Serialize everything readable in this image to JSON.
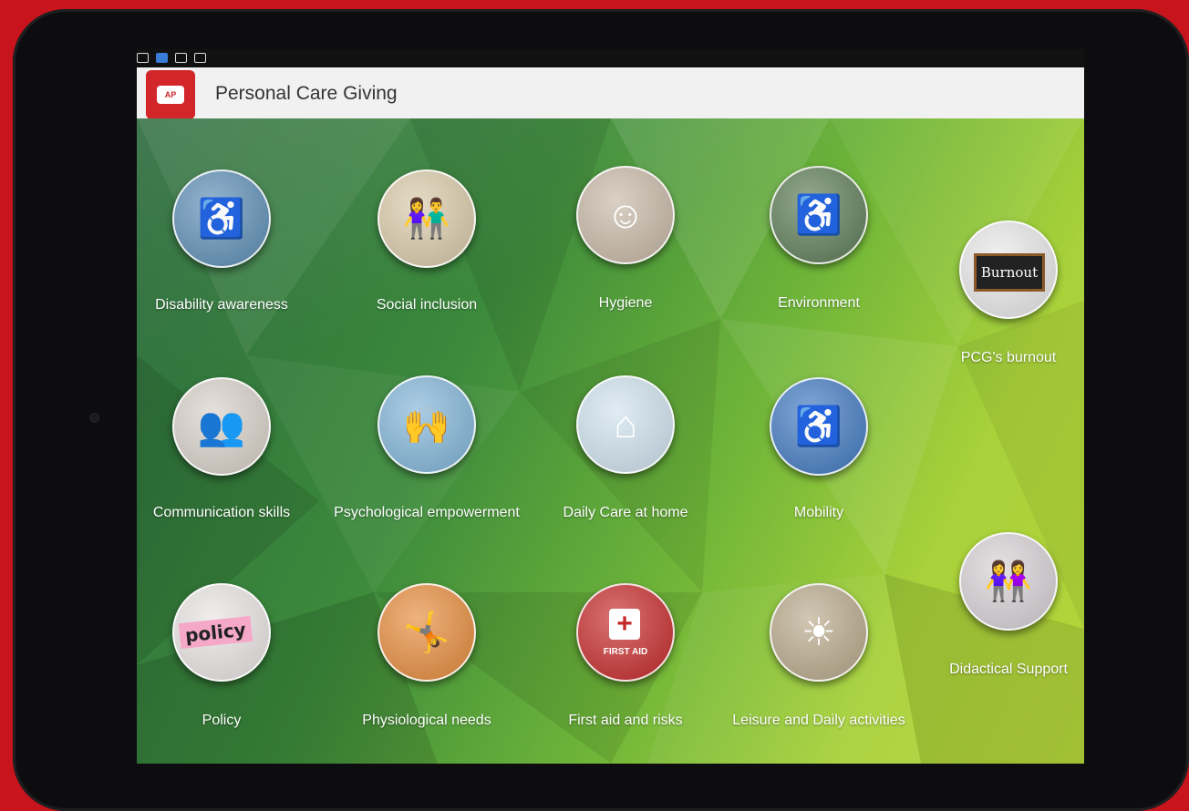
{
  "app": {
    "title": "Personal Care Giving",
    "logo_text": "AP"
  },
  "tiles": [
    {
      "label": "Disability awareness",
      "icon": "wheelchair-person-icon",
      "bg": "#5b8db5"
    },
    {
      "label": "Social inclusion",
      "icon": "paper-people-icon",
      "bg": "#d9c9a8"
    },
    {
      "label": "Hygiene",
      "icon": "elderly-face-icon",
      "bg": "#c7b7a5"
    },
    {
      "label": "Environment",
      "icon": "wheelchair-park-icon",
      "bg": "#5b7a55"
    },
    {
      "label": "PCG's burnout",
      "icon": "burnout-board-icon",
      "bg": "#e8e8e8"
    },
    {
      "label": "Communication skills",
      "icon": "meeting-icon",
      "bg": "#d8d0c8"
    },
    {
      "label": "Psychological empowerment",
      "icon": "arms-raised-icon",
      "bg": "#7fb4d8"
    },
    {
      "label": "Daily Care at home",
      "icon": "house-wheelchair-icon",
      "bg": "#cfe2ee"
    },
    {
      "label": "Mobility",
      "icon": "accessibility-sign-icon",
      "bg": "#3f78c0"
    },
    {
      "label": "Didactical Support",
      "icon": "two-women-icon",
      "bg": "#d6d0d4"
    },
    {
      "label": "Policy",
      "icon": "policy-text-icon",
      "bg": "#e9e4e4"
    },
    {
      "label": "Physiological needs",
      "icon": "exercise-icon",
      "bg": "#e68a3a"
    },
    {
      "label": "First aid and risks",
      "icon": "first-aid-kit-icon",
      "bg": "#c62828"
    },
    {
      "label": "Leisure and Daily activities",
      "icon": "sunset-silhouette-icon",
      "bg": "#b8a88a"
    }
  ],
  "tile_art": {
    "burnout_text": "Burnout",
    "policy_text": "policy",
    "first_aid_text": "FIRST AID"
  }
}
